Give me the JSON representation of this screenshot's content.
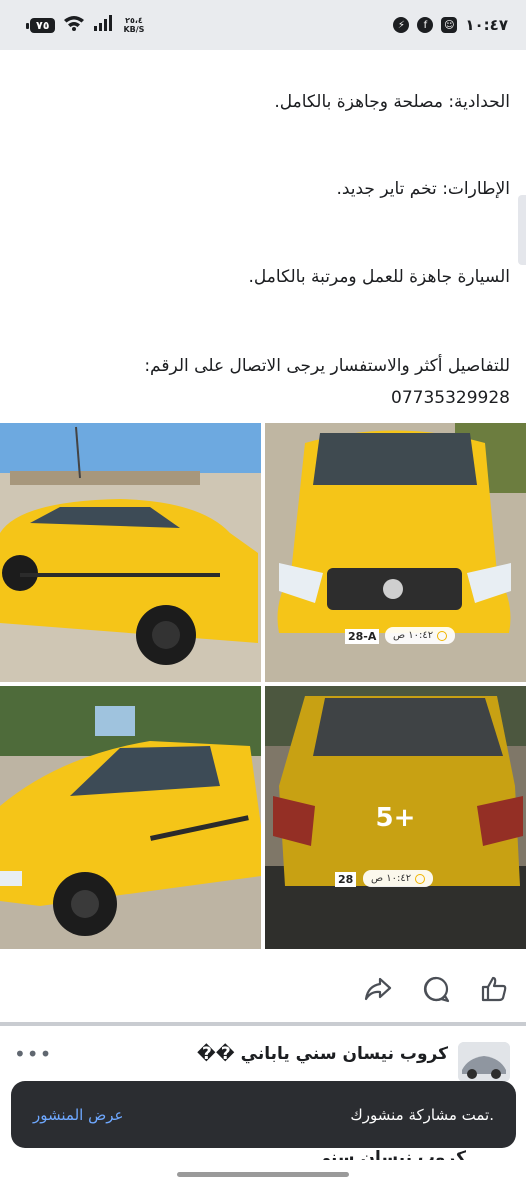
{
  "status_bar": {
    "battery": "٧٥",
    "net_speed_value": "٢٥،٤",
    "net_speed_unit": "KB/S",
    "time": "١٠:٤٧"
  },
  "post": {
    "lines": [
      "الحدادية: مصلحة وجاهزة بالكامل.",
      "الإطارات: تخم تاير جديد.",
      "السيارة جاهزة للعمل ومرتبة بالكامل.",
      "للتفاصيل أكثر والاستفسار يرجى الاتصال على الرقم:",
      "07735329928"
    ],
    "photo_stamp_time": "١٠:٤٢ ص",
    "more_photos_label": "5+",
    "plate_partial_1": "28-A",
    "plate_partial_2": "28",
    "car_color": "#f5c518"
  },
  "actions": {
    "like_icon": "thumbs-up-icon",
    "comment_icon": "comment-icon",
    "share_icon": "share-icon"
  },
  "next_post": {
    "group_title": "كروب نيسان سني ياباني ��",
    "more_label": "•••"
  },
  "toast": {
    "message": "تمت مشاركة منشورك.",
    "action_label": "عرض المنشور"
  },
  "peek_text": "كروب نيسان سني"
}
